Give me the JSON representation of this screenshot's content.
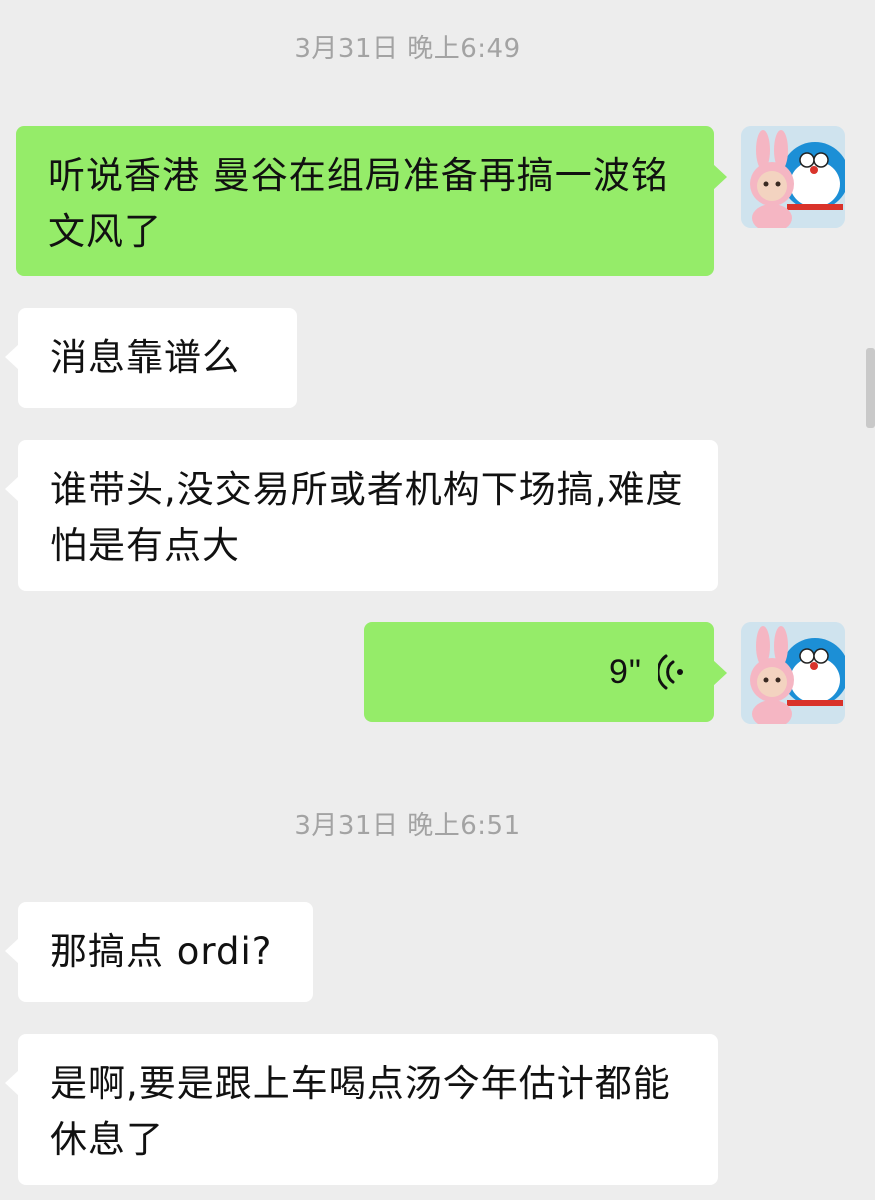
{
  "timestamps": [
    "3月31日 晚上6:49",
    "3月31日 晚上6:51"
  ],
  "messages": [
    {
      "side": "out",
      "type": "text",
      "text": "听说香港 曼谷在组局准备再搞一波铭文风了"
    },
    {
      "side": "in",
      "type": "text",
      "text": "消息靠谱么"
    },
    {
      "side": "in",
      "type": "text",
      "text": "谁带头,没交易所或者机构下场搞,难度怕是有点大"
    },
    {
      "side": "out",
      "type": "voice",
      "duration": "9\"",
      "icon": "voice-wave-icon"
    },
    {
      "side": "in",
      "type": "text",
      "text": "那搞点 ordi?"
    },
    {
      "side": "in",
      "type": "text",
      "text": "是啊,要是跟上车喝点汤今年估计都能休息了"
    }
  ],
  "colors": {
    "background": "#ededed",
    "outgoing_bubble": "#95ec69",
    "incoming_bubble": "#ffffff",
    "timestamp": "#a3a3a3"
  },
  "avatar_icon": "bunny-doraemon-avatar"
}
